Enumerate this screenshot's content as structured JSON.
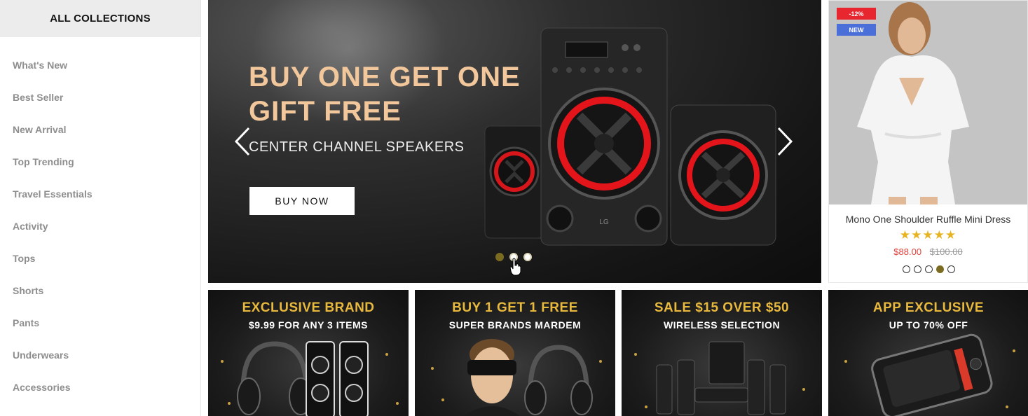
{
  "sidebar": {
    "header": "ALL COLLECTIONS",
    "items": [
      {
        "label": "What's New"
      },
      {
        "label": "Best Seller"
      },
      {
        "label": "New Arrival"
      },
      {
        "label": "Top Trending"
      },
      {
        "label": "Travel Essentials"
      },
      {
        "label": "Activity"
      },
      {
        "label": "Tops"
      },
      {
        "label": "Shorts"
      },
      {
        "label": "Pants"
      },
      {
        "label": "Underwears"
      },
      {
        "label": "Accessories"
      }
    ]
  },
  "hero": {
    "title_line1": "BUY ONE GET ONE",
    "title_line2": "GIFT FREE",
    "subtitle": "CENTER CHANNEL SPEAKERS",
    "button": "BUY NOW",
    "speaker_brand": "LG",
    "active_slide": 1,
    "slide_count": 3,
    "title_color": "#f1c79b"
  },
  "product": {
    "badge_sale": "-12%",
    "badge_new": "NEW",
    "name": "Mono One Shoulder Ruffle Mini Dress",
    "stars": "★★★★★",
    "rating": 5,
    "price": "$88.00",
    "old_price": "$100.00",
    "swatch_count": 5,
    "active_swatch": 4
  },
  "banners": [
    {
      "title": "EXCLUSIVE BRAND",
      "subtitle": "$9.99 FOR ANY 3 ITEMS"
    },
    {
      "title": "BUY 1 GET 1 FREE",
      "subtitle": "SUPER BRANDS MARDEM"
    },
    {
      "title": "SALE $15 OVER $50",
      "subtitle": "WIRELESS SELECTION"
    },
    {
      "title": "APP EXCLUSIVE",
      "subtitle": "UP TO 70% OFF"
    }
  ],
  "colors": {
    "accent_gold": "#e9b93d",
    "sale_red": "#e8262f",
    "new_blue": "#4b6fd8",
    "price_red": "#e33f3a",
    "star_yellow": "#e8b321",
    "active_dot": "#7a6b21"
  }
}
